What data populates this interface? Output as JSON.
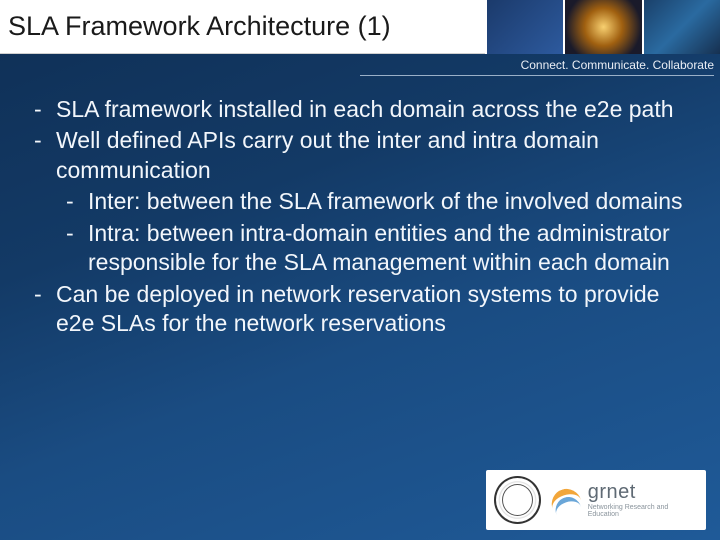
{
  "header": {
    "title": "SLA Framework Architecture (1)",
    "tagline": "Connect. Communicate. Collaborate"
  },
  "bullets": [
    {
      "level": 1,
      "text": "SLA framework installed in each domain across the e2e path"
    },
    {
      "level": 1,
      "text": "Well defined APIs carry out the inter and intra domain communication"
    },
    {
      "level": 2,
      "text": "Inter: between the SLA framework of the involved domains"
    },
    {
      "level": 2,
      "text": "Intra: between intra-domain entities and the administrator responsible for the SLA management within each domain"
    },
    {
      "level": 1,
      "text": "Can be deployed in network reservation systems to provide e2e SLAs for the network reservations"
    }
  ],
  "footer": {
    "logo_name": "grnet",
    "logo_sub": "Networking Research and Education"
  }
}
